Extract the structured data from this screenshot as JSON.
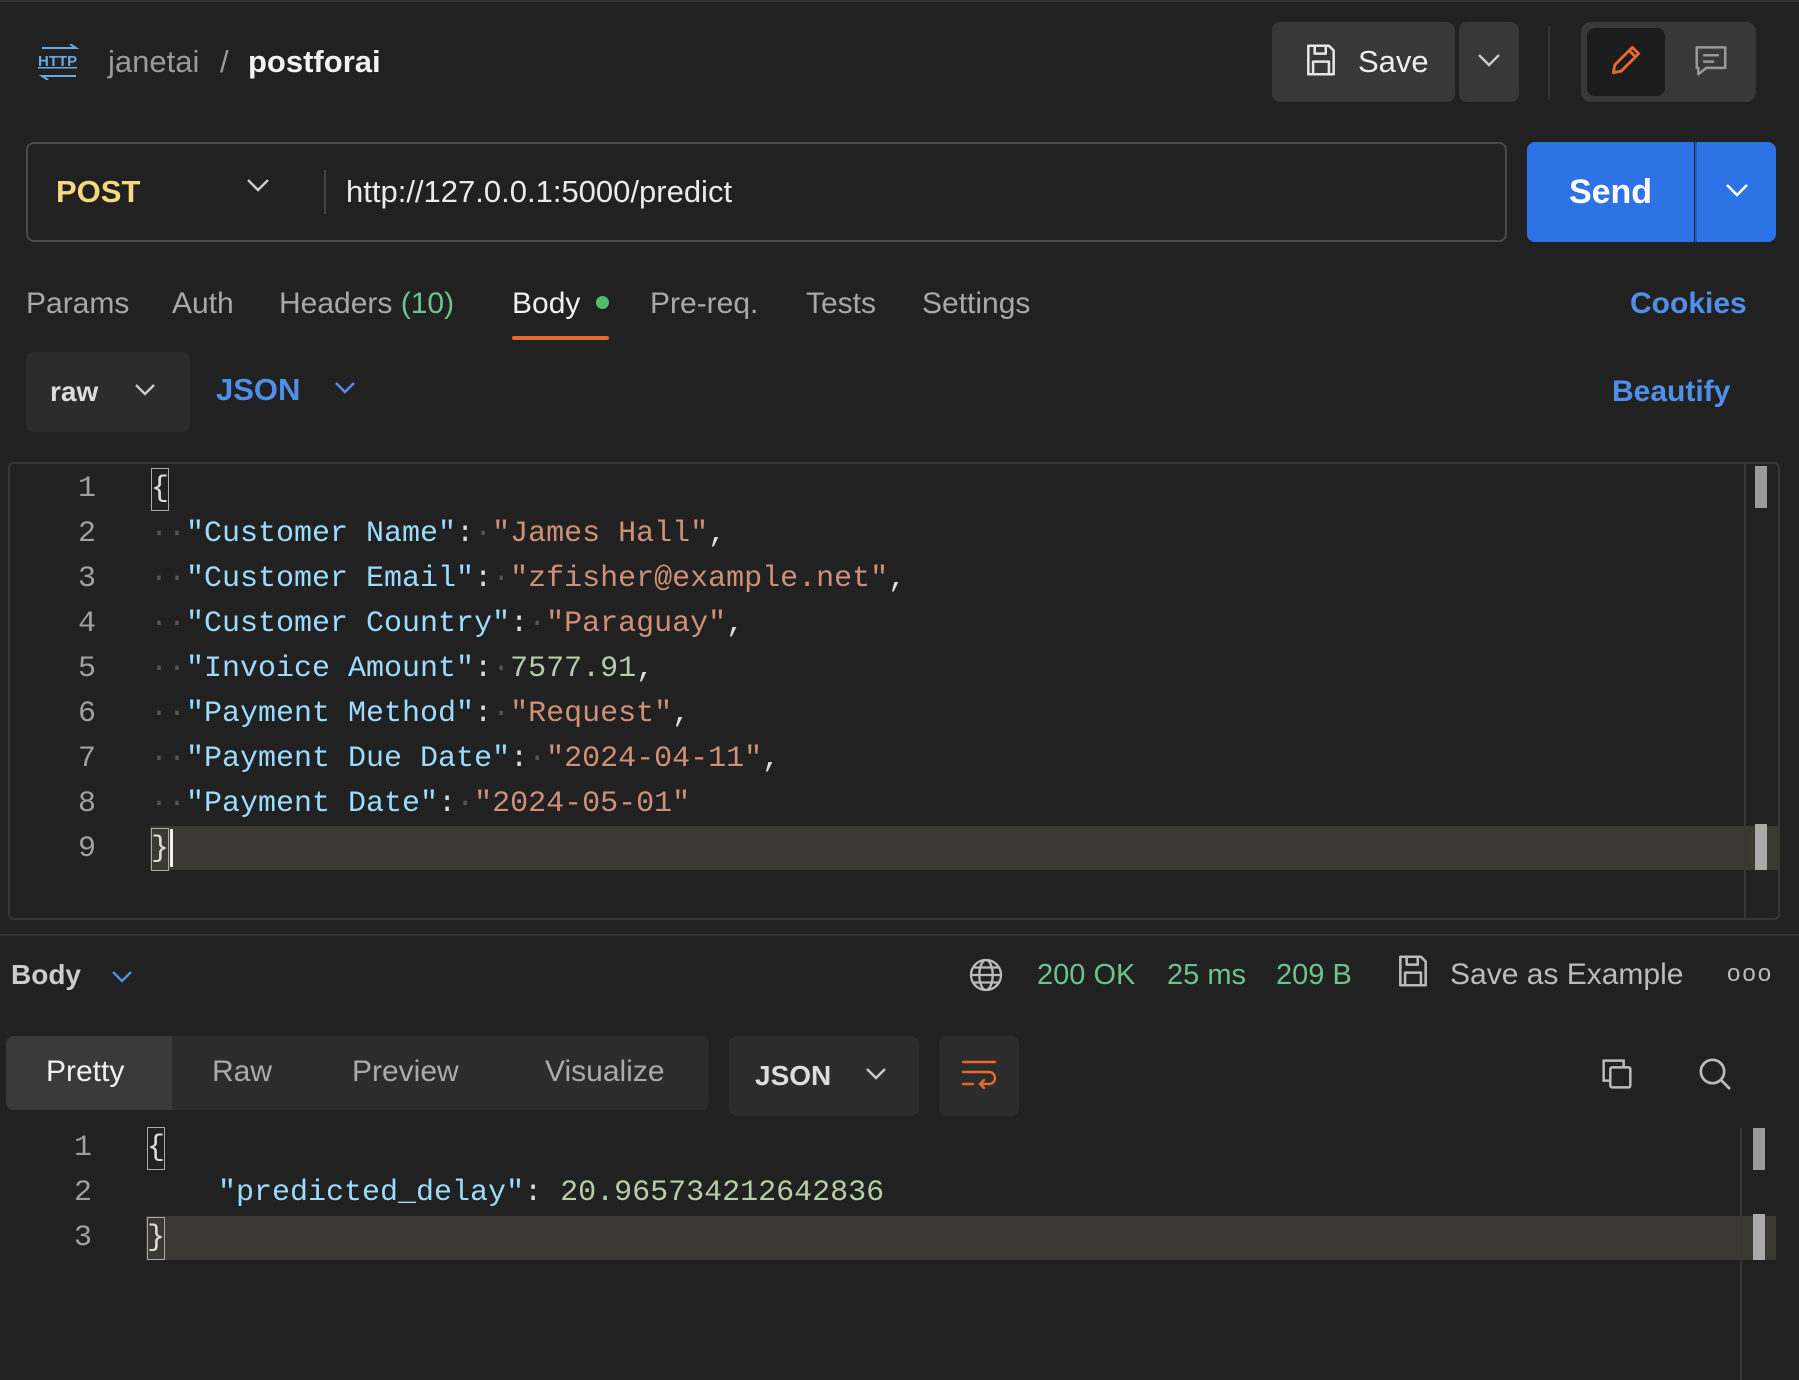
{
  "header": {
    "request_type_icon": "http-icon",
    "workspace": "janetai",
    "separator": "/",
    "request_name": "postforai",
    "save_label": "Save"
  },
  "request": {
    "method": "POST",
    "url": "http://127.0.0.1:5000/predict",
    "send_label": "Send"
  },
  "tabs": {
    "params": "Params",
    "auth": "Auth",
    "headers": "Headers",
    "headers_count": "(10)",
    "body": "Body",
    "prereq": "Pre-req.",
    "tests": "Tests",
    "settings": "Settings",
    "cookies": "Cookies",
    "active": "Body"
  },
  "body_options": {
    "mode": "raw",
    "language": "JSON",
    "beautify": "Beautify"
  },
  "request_body": {
    "line_numbers": [
      "1",
      "2",
      "3",
      "4",
      "5",
      "6",
      "7",
      "8",
      "9"
    ],
    "open": "{",
    "close": "}",
    "fields": [
      {
        "key": "\"Customer Name\"",
        "value": "\"James Hall\"",
        "type": "string"
      },
      {
        "key": "\"Customer Email\"",
        "value": "\"zfisher@example.net\"",
        "type": "string"
      },
      {
        "key": "\"Customer Country\"",
        "value": "\"Paraguay\"",
        "type": "string"
      },
      {
        "key": "\"Invoice Amount\"",
        "value": "7577.91",
        "type": "number"
      },
      {
        "key": "\"Payment Method\"",
        "value": "\"Request\"",
        "type": "string"
      },
      {
        "key": "\"Payment Due Date\"",
        "value": "\"2024-04-11\"",
        "type": "string"
      },
      {
        "key": "\"Payment Date\"",
        "value": "\"2024-05-01\"",
        "type": "string"
      }
    ]
  },
  "response": {
    "section_label": "Body",
    "status": "200 OK",
    "time": "25 ms",
    "size": "209 B",
    "save_example": "Save as Example",
    "more": "ooo",
    "view_tabs": [
      "Pretty",
      "Raw",
      "Preview",
      "Visualize"
    ],
    "active_view": "Pretty",
    "format": "JSON",
    "line_numbers": [
      "1",
      "2",
      "3"
    ],
    "open": "{",
    "close": "}",
    "key": "\"predicted_delay\"",
    "value": "20.965734212642836"
  },
  "colors": {
    "background": "#212121",
    "accent_blue": "#2e73e6",
    "link_blue": "#4f8fe8",
    "method_yellow": "#f3d87c",
    "success_green": "#6bc38d",
    "active_tab_underline": "#e6692e",
    "json_key": "#9cdcfe",
    "json_string": "#ce9178",
    "json_number": "#b5cea8"
  }
}
